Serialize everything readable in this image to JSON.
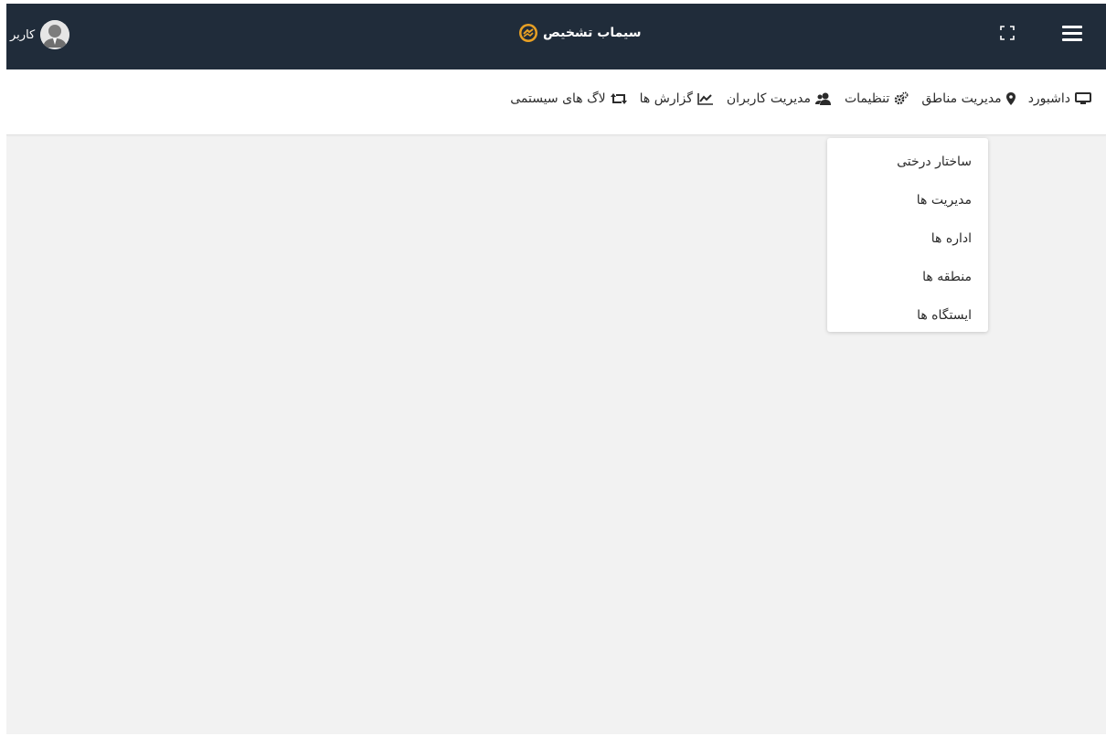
{
  "header": {
    "brand": "سیماب تشخیص",
    "user_label": "کاربر",
    "icons": [
      "menu-icon",
      "fullscreen-icon",
      "logo-icon",
      "avatar"
    ],
    "colors": {
      "bar": "#202c3a",
      "logo_accent": "#e8a024",
      "page_bg": "#f2f2f2"
    }
  },
  "nav": {
    "items": [
      {
        "label": "داشبورد",
        "icon": "monitor-icon"
      },
      {
        "label": "مدیریت مناطق",
        "icon": "map-marker-icon"
      },
      {
        "label": "تنظیمات",
        "icon": "gears-icon"
      },
      {
        "label": "مدیریت کاربران",
        "icon": "users-icon"
      },
      {
        "label": "گزارش ها",
        "icon": "chart-line-icon"
      },
      {
        "label": "لاگ های سیستمی",
        "icon": "retweet-icon"
      }
    ]
  },
  "dropdown": {
    "items": [
      {
        "label": "ساختار درختی"
      },
      {
        "label": "مدیریت ها"
      },
      {
        "label": "اداره ها"
      },
      {
        "label": "منطقه ها"
      },
      {
        "label": "ایستگاه ها"
      }
    ]
  }
}
